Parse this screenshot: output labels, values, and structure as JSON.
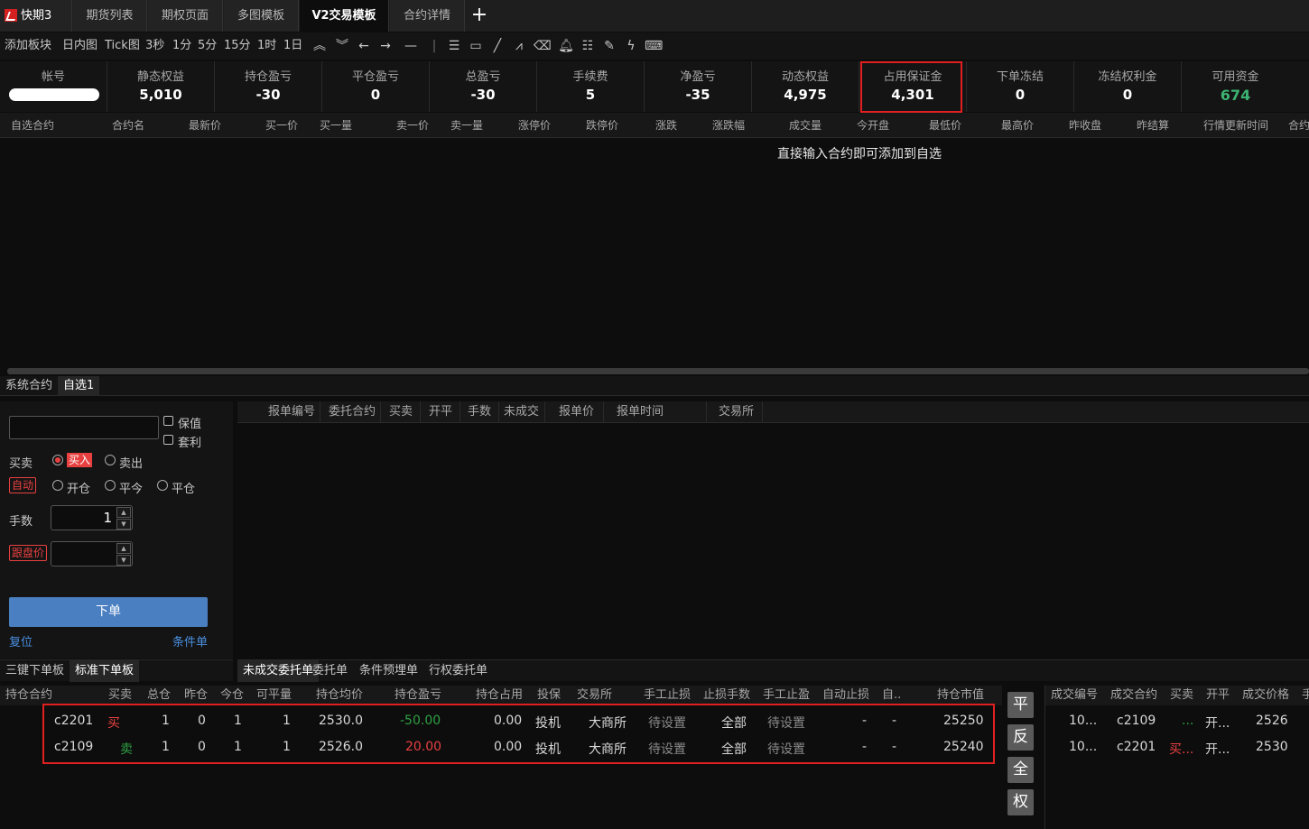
{
  "app": {
    "name": "快期3"
  },
  "tabs": [
    "期货列表",
    "期权页面",
    "多图模板",
    "V2交易模板",
    "合约详情"
  ],
  "toolbar": {
    "add_block": "添加板块",
    "intervals": [
      "日内图",
      "Tick图",
      "3秒",
      "1分",
      "5分",
      "15分",
      "1时",
      "1日"
    ]
  },
  "account": {
    "cells": [
      {
        "label": "帐号",
        "value": ""
      },
      {
        "label": "静态权益",
        "value": "5,010"
      },
      {
        "label": "持仓盈亏",
        "value": "-30"
      },
      {
        "label": "平仓盈亏",
        "value": "0"
      },
      {
        "label": "总盈亏",
        "value": "-30"
      },
      {
        "label": "手续费",
        "value": "5"
      },
      {
        "label": "净盈亏",
        "value": "-35"
      },
      {
        "label": "动态权益",
        "value": "4,975"
      },
      {
        "label": "占用保证金",
        "value": "4,301"
      },
      {
        "label": "下单冻结",
        "value": "0"
      },
      {
        "label": "冻结权利金",
        "value": "0"
      },
      {
        "label": "可用资金",
        "value": "674"
      }
    ]
  },
  "quote": {
    "columns": [
      "自选合约",
      "合约名",
      "最新价",
      "买一价",
      "买一量",
      "卖一价",
      "卖一量",
      "涨停价",
      "跌停价",
      "涨跌",
      "涨跌幅",
      "成交量",
      "今开盘",
      "最低价",
      "最高价",
      "昨收盘",
      "昨结算",
      "行情更新时间",
      "合约"
    ],
    "hint": "直接输入合约即可添加到自选",
    "list_tabs": [
      "系统合约",
      "自选1"
    ]
  },
  "order_form": {
    "hedge": "保值",
    "arbitrage": "套利",
    "side_label": "买卖",
    "buy": "买入",
    "sell": "卖出",
    "auto": "自动",
    "open": "开仓",
    "close_today": "平今",
    "close": "平仓",
    "qty_label": "手数",
    "qty": "1",
    "price_label": "跟盘价",
    "price": "",
    "submit": "下单",
    "reset": "复位",
    "conditional": "条件单",
    "panel_tabs": [
      "三键下单板",
      "标准下单板"
    ]
  },
  "orders": {
    "columns": [
      "报单编号",
      "委托合约",
      "买卖",
      "开平",
      "手数",
      "未成交",
      "报单价",
      "报单时间",
      "交易所"
    ],
    "tabs": [
      "未成交委托单",
      "委托单",
      "条件预埋单",
      "行权委托单"
    ]
  },
  "positions": {
    "columns": [
      "持仓合约",
      "买卖",
      "总仓",
      "昨仓",
      "今仓",
      "可平量",
      "持仓均价",
      "持仓盈亏",
      "持仓占用",
      "投保",
      "交易所",
      "手工止损",
      "止损手数",
      "手工止盈",
      "自动止损",
      "自..",
      "持仓市值"
    ],
    "rows": [
      {
        "contract": "c2201",
        "side": "买",
        "total": "1",
        "yesterday": "0",
        "today": "1",
        "closable": "1",
        "avg_price": "2530.0",
        "pnl": "-50.00",
        "margin": "0.00",
        "hedge": "投机",
        "exchange": "大商所",
        "manual_stop": "待设置",
        "stop_qty": "全部",
        "manual_profit": "待设置",
        "auto_stop": "-",
        "auto2": "-",
        "market_value": "25250"
      },
      {
        "contract": "c2109",
        "side": "卖",
        "total": "1",
        "yesterday": "0",
        "today": "1",
        "closable": "1",
        "avg_price": "2526.0",
        "pnl": "20.00",
        "margin": "0.00",
        "hedge": "投机",
        "exchange": "大商所",
        "manual_stop": "待设置",
        "stop_qty": "全部",
        "manual_profit": "待设置",
        "auto_stop": "-",
        "auto2": "-",
        "market_value": "25240"
      }
    ],
    "side_buttons": [
      "平",
      "反",
      "全",
      "权"
    ]
  },
  "trades": {
    "columns": [
      "成交编号",
      "成交合约",
      "买卖",
      "开平",
      "成交价格",
      "手"
    ],
    "rows": [
      {
        "id": "10...",
        "contract": "c2109",
        "side": "...",
        "offset": "开...",
        "price": "2526"
      },
      {
        "id": "10...",
        "contract": "c2201",
        "side": "买...",
        "offset": "开...",
        "price": "2530"
      }
    ]
  },
  "colors": {
    "accent_red": "#e02020",
    "positive": "#e84040",
    "negative": "#2ea043",
    "button_blue": "#4a7fc1"
  }
}
